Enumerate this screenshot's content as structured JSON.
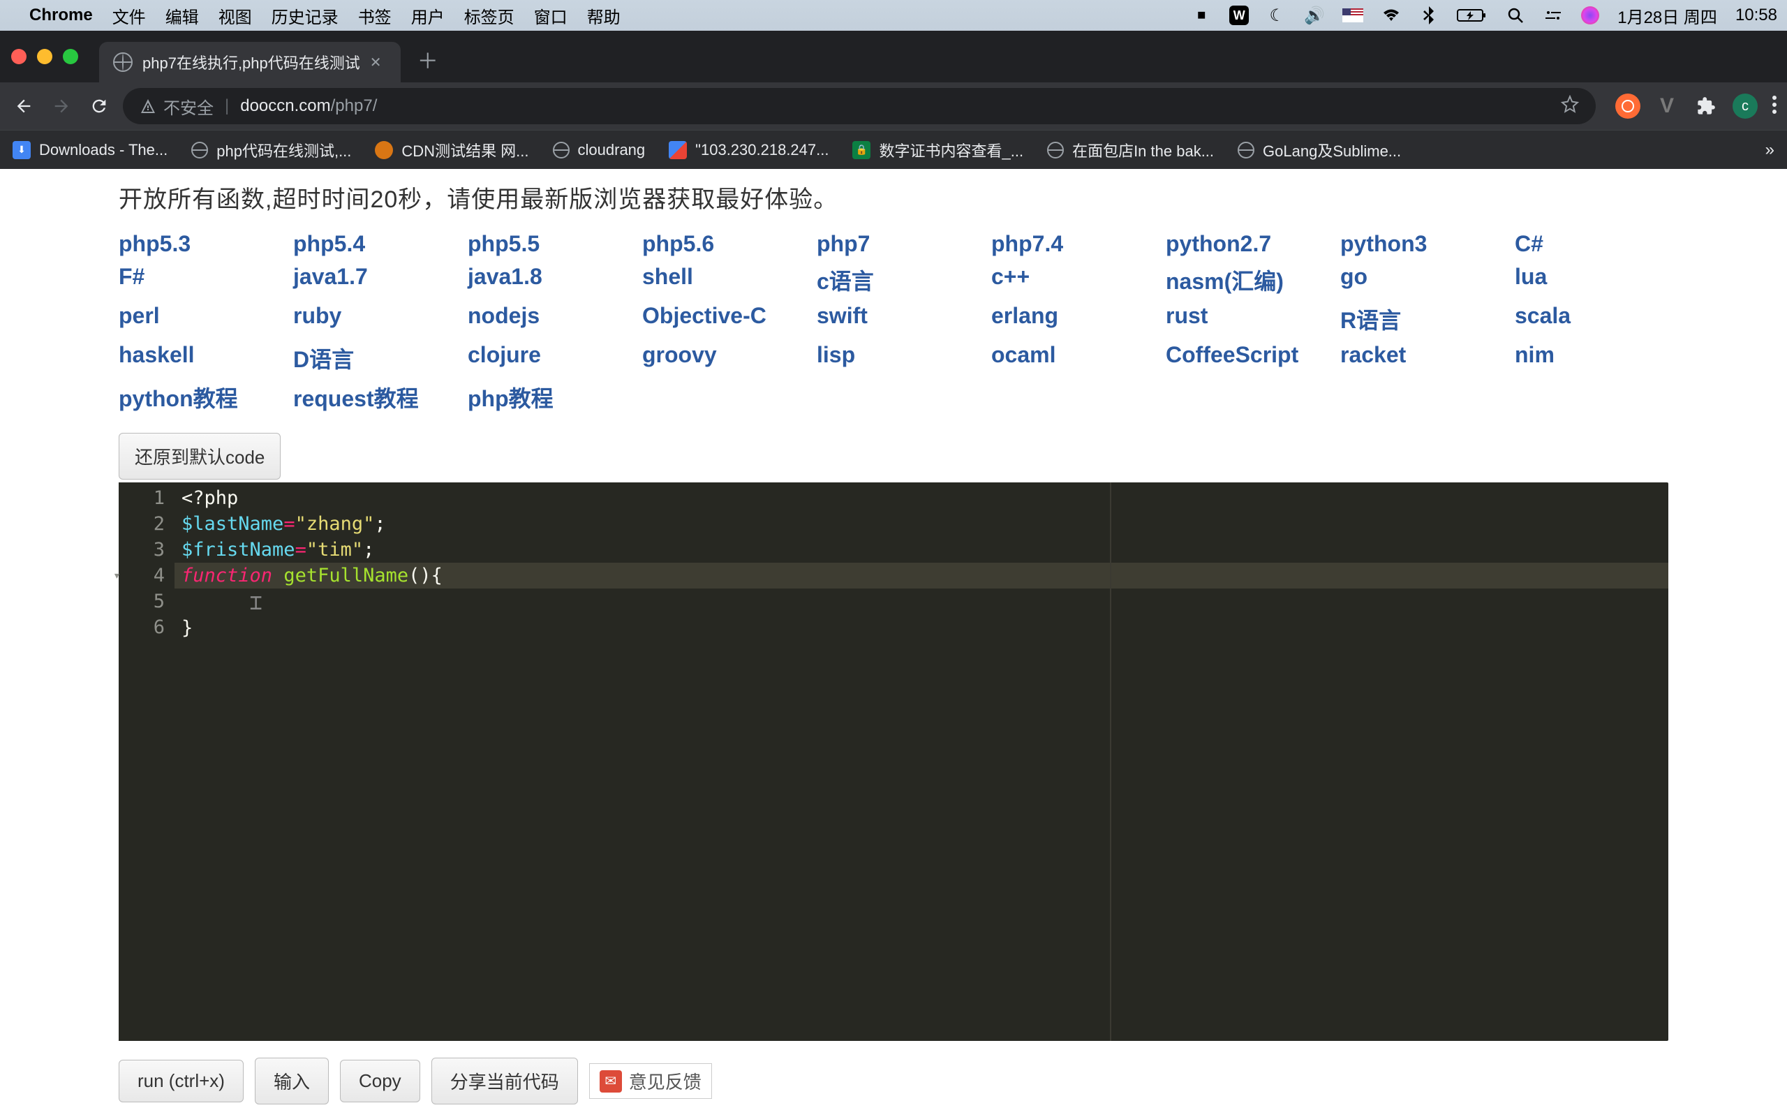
{
  "menubar": {
    "app": "Chrome",
    "items": [
      "文件",
      "编辑",
      "视图",
      "历史记录",
      "书签",
      "用户",
      "标签页",
      "窗口",
      "帮助"
    ],
    "date": "1月28日 周四",
    "time": "10:58"
  },
  "tab": {
    "title": "php7在线执行,php代码在线测试"
  },
  "omnibox": {
    "insecure_label": "不安全",
    "domain": "dooccn.com",
    "path": "/php7/"
  },
  "avatar_letter": "c",
  "bookmarks": [
    {
      "label": "Downloads - The...",
      "icon": "blue"
    },
    {
      "label": "php代码在线测试,...",
      "icon": "globe"
    },
    {
      "label": "CDN测试结果 网...",
      "icon": "orange"
    },
    {
      "label": "cloudrang",
      "icon": "globe"
    },
    {
      "label": "\"103.230.218.247...",
      "icon": "multi"
    },
    {
      "label": "数字证书内容查看_...",
      "icon": "green"
    },
    {
      "label": "在面包店In the bak...",
      "icon": "globe"
    },
    {
      "label": "GoLang及Sublime...",
      "icon": "globe"
    }
  ],
  "intro": "开放所有函数,超时时间20秒，请使用最新版浏览器获取最好体验。",
  "langs": [
    "php5.3",
    "php5.4",
    "php5.5",
    "php5.6",
    "php7",
    "php7.4",
    "python2.7",
    "python3",
    "C#",
    "F#",
    "java1.7",
    "java1.8",
    "shell",
    "c语言",
    "c++",
    "nasm(汇编)",
    "go",
    "lua",
    "perl",
    "ruby",
    "nodejs",
    "Objective-C",
    "swift",
    "erlang",
    "rust",
    "R语言",
    "scala",
    "haskell",
    "D语言",
    "clojure",
    "groovy",
    "lisp",
    "ocaml",
    "CoffeeScript",
    "racket",
    "nim",
    "python教程",
    "request教程",
    "php教程"
  ],
  "reset_btn": "还原到默认code",
  "lines": [
    "1",
    "2",
    "3",
    "4",
    "5",
    "6"
  ],
  "code": {
    "l1": "<?php",
    "l2_var": "$lastName",
    "l2_str": "\"zhang\"",
    "l3_var": "$fristName",
    "l3_str": "\"tim\"",
    "l4_kw": "function",
    "l4_fn": "getFullName",
    "l4_rest": "(){",
    "l6": "}"
  },
  "actions": {
    "run": "run (ctrl+x)",
    "input": "输入",
    "copy": "Copy",
    "share": "分享当前代码",
    "feedback": "意见反馈"
  }
}
